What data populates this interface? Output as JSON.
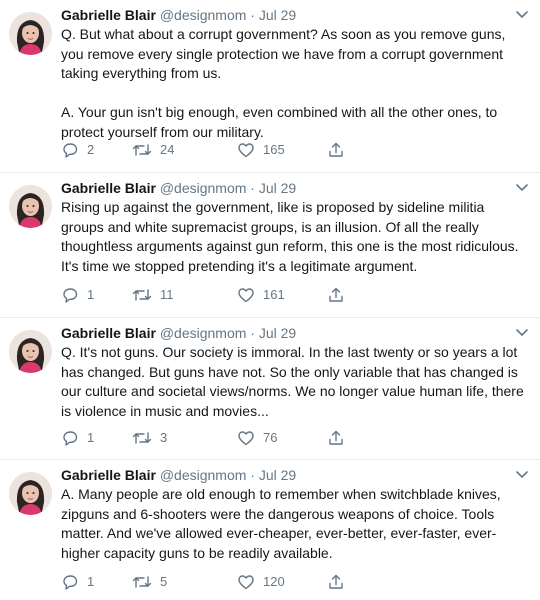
{
  "accent_muted": "#657786",
  "text_color": "#14171a",
  "tweets": [
    {
      "name": "Gabrielle Blair",
      "handle": "@designmom",
      "separator": "·",
      "date": "Jul 29",
      "text": "Q. But what about a corrupt government? As soon as you remove guns, you remove every single protection we have from a corrupt government taking everything from us.\n\nA. Your gun isn't big enough, even combined with all the other ones, to protect yourself from our military.",
      "replies": "2",
      "retweets": "24",
      "likes": "165"
    },
    {
      "name": "Gabrielle Blair",
      "handle": "@designmom",
      "separator": "·",
      "date": "Jul 29",
      "text": "Rising up against the government, like is proposed by sideline militia groups and white supremacist groups, is an illusion. Of all the really thoughtless arguments against gun reform, this one is the most ridiculous. It's time we stopped pretending it's a legitimate argument.",
      "replies": "1",
      "retweets": "11",
      "likes": "161"
    },
    {
      "name": "Gabrielle Blair",
      "handle": "@designmom",
      "separator": "·",
      "date": "Jul 29",
      "text": "Q. It's not guns. Our society is immoral. In the last twenty or so years a lot has changed. But guns have not. So the only variable that has changed is our culture and societal views/norms. We no longer value human life, there is violence in music and movies...",
      "replies": "1",
      "retweets": "3",
      "likes": "76"
    },
    {
      "name": "Gabrielle Blair",
      "handle": "@designmom",
      "separator": "·",
      "date": "Jul 29",
      "text": "A. Many people are old enough to remember when switchblade knives, zipguns and 6-shooters were the dangerous weapons of choice. Tools matter. And we've allowed ever-cheaper, ever-better, ever-faster, ever-higher capacity guns to be readily available.",
      "replies": "1",
      "retweets": "5",
      "likes": "120"
    }
  ],
  "icons": {
    "reply": "reply-icon",
    "retweet": "retweet-icon",
    "like": "heart-icon",
    "share": "share-icon",
    "caret": "chevron-down-icon",
    "avatar": "avatar"
  }
}
